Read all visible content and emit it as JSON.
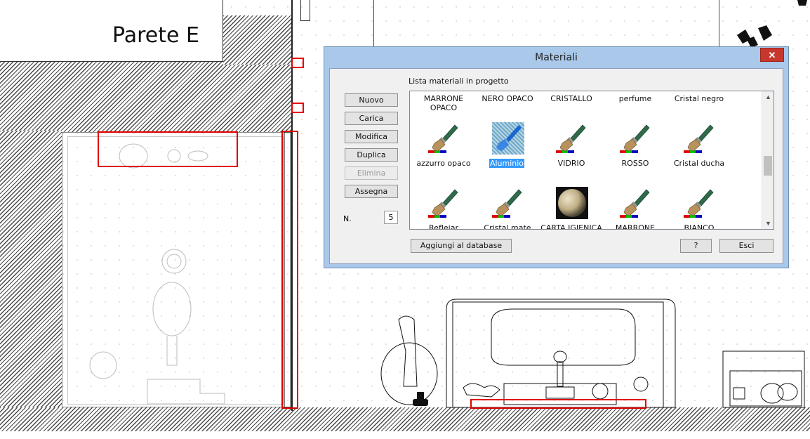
{
  "canvas": {
    "wall_label": "Parete E"
  },
  "dialog": {
    "title": "Materiali",
    "close_label": "✕",
    "list_title": "Lista materiali in progetto",
    "side_buttons": [
      "Nuovo",
      "Carica",
      "Modifica",
      "Duplica",
      "Elimina",
      "Assegna"
    ],
    "count_label": "N.",
    "count_value": "5",
    "add_db_label": "Aggiungi al database",
    "help_label": "?",
    "exit_label": "Esci",
    "materials": [
      {
        "name": "MARRONE OPACO",
        "icon": "paint-brush-icon"
      },
      {
        "name": "NERO OPACO",
        "icon": "paint-brush-icon"
      },
      {
        "name": "CRISTALLO",
        "icon": "paint-brush-icon"
      },
      {
        "name": "perfume",
        "icon": "paint-brush-icon"
      },
      {
        "name": "Cristal negro",
        "icon": "paint-brush-icon"
      },
      {
        "name": "azzurro opaco",
        "icon": "paint-brush-icon"
      },
      {
        "name": "Aluminio",
        "icon": "texture-thumbnail",
        "selected": true
      },
      {
        "name": "VIDRIO",
        "icon": "paint-brush-icon"
      },
      {
        "name": "ROSSO",
        "icon": "paint-brush-icon"
      },
      {
        "name": "Cristal ducha",
        "icon": "paint-brush-icon"
      },
      {
        "name": "Reflejar",
        "icon": "paint-brush-icon"
      },
      {
        "name": "Cristal mate",
        "icon": "paint-brush-icon"
      },
      {
        "name": "CARTA IGIENICA",
        "icon": "sphere-thumbnail"
      },
      {
        "name": "MARRONE",
        "icon": "paint-brush-icon"
      },
      {
        "name": "BIANCO",
        "icon": "paint-brush-icon"
      }
    ]
  },
  "colors": {
    "dialog_frame": "#a9c8ea",
    "selection": "#3399ff",
    "highlight_box": "#e00000",
    "close_button": "#c8372d",
    "rgb_strip": [
      "#e00000",
      "#00c000",
      "#0000c0"
    ]
  }
}
